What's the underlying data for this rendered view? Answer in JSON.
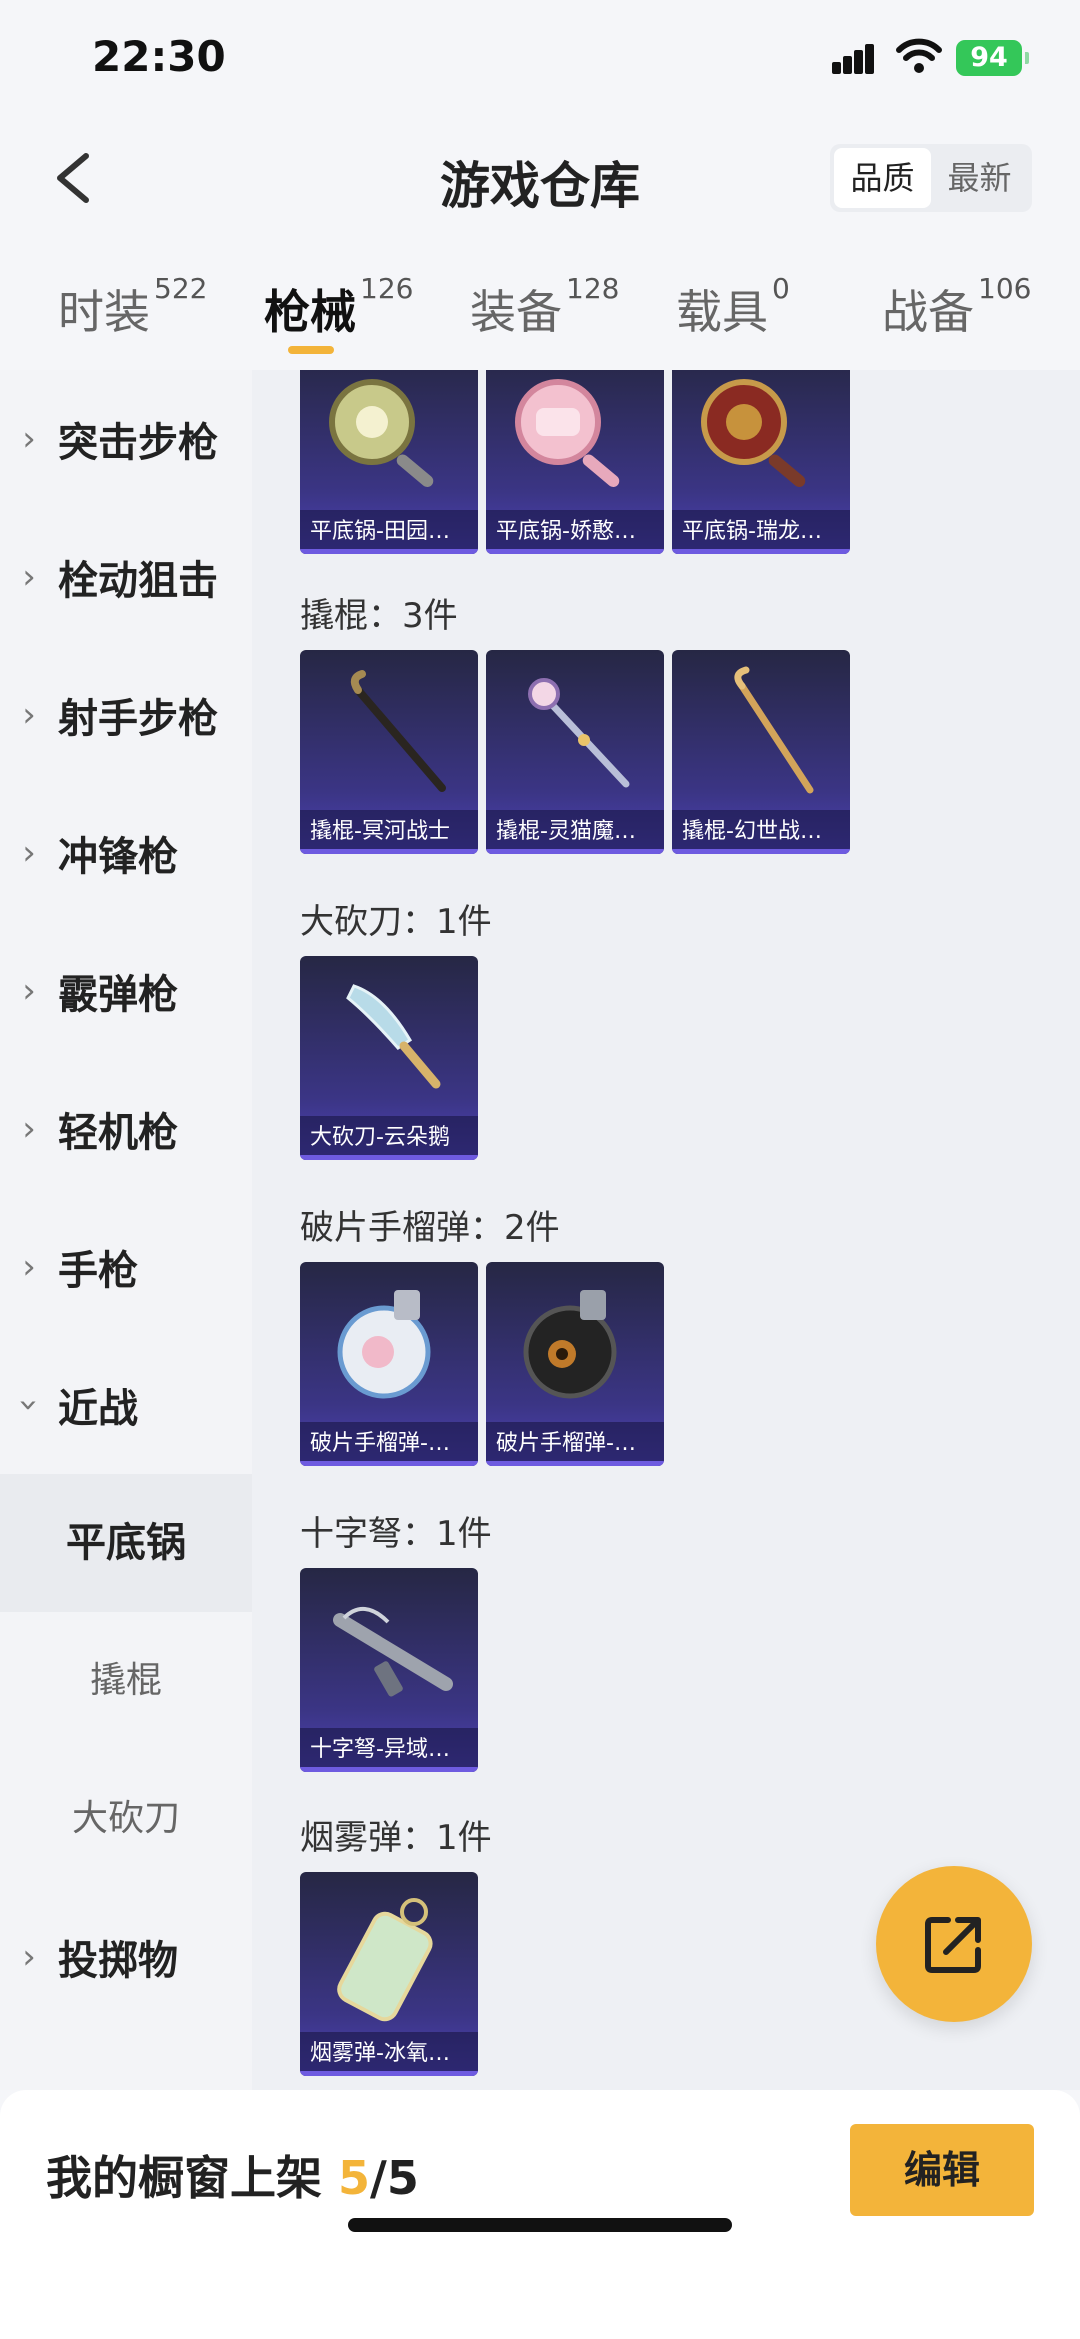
{
  "status": {
    "time": "22:30",
    "battery": "94"
  },
  "header": {
    "title": "游戏仓库",
    "sort_options": [
      "品质",
      "最新"
    ],
    "sort_active": "品质"
  },
  "tabs": [
    {
      "label": "时装",
      "count": "522"
    },
    {
      "label": "枪械",
      "count": "126"
    },
    {
      "label": "装备",
      "count": "128"
    },
    {
      "label": "载具",
      "count": "0"
    },
    {
      "label": "战备",
      "count": "106"
    }
  ],
  "active_tab": "枪械",
  "sidebar": {
    "categories": [
      "突击步枪",
      "栓动狙击",
      "射手步枪",
      "冲锋枪",
      "霰弹枪",
      "轻机枪",
      "手枪",
      "近战"
    ],
    "sub_items": [
      "平底锅",
      "撬棍",
      "大砍刀"
    ],
    "active_sub": "平底锅",
    "after": [
      "投掷物"
    ]
  },
  "groups": [
    {
      "title": "",
      "items": [
        "平底锅-田园…",
        "平底锅-娇憨…",
        "平底锅-瑞龙…"
      ]
    },
    {
      "title": "撬棍：3件",
      "items": [
        "撬棍-冥河战士",
        "撬棍-灵猫魔…",
        "撬棍-幻世战…"
      ]
    },
    {
      "title": "大砍刀：1件",
      "items": [
        "大砍刀-云朵鹅"
      ]
    },
    {
      "title": "破片手榴弹：2件",
      "items": [
        "破片手榴弹-…",
        "破片手榴弹-…"
      ]
    },
    {
      "title": "十字弩：1件",
      "items": [
        "十字弩-异域…"
      ]
    },
    {
      "title": "烟雾弹：1件",
      "items": [
        "烟雾弹-冰氧…"
      ]
    }
  ],
  "bottom": {
    "showcase_label": "我的橱窗上架",
    "showcase_current": "5",
    "showcase_total": "/5",
    "edit_label": "编辑"
  },
  "icons": {
    "back": "chevron-left-icon",
    "share": "share-external-icon"
  },
  "colors": {
    "accent": "#f3b43a",
    "card_bg": "#3b3585",
    "battery": "#34c759"
  }
}
